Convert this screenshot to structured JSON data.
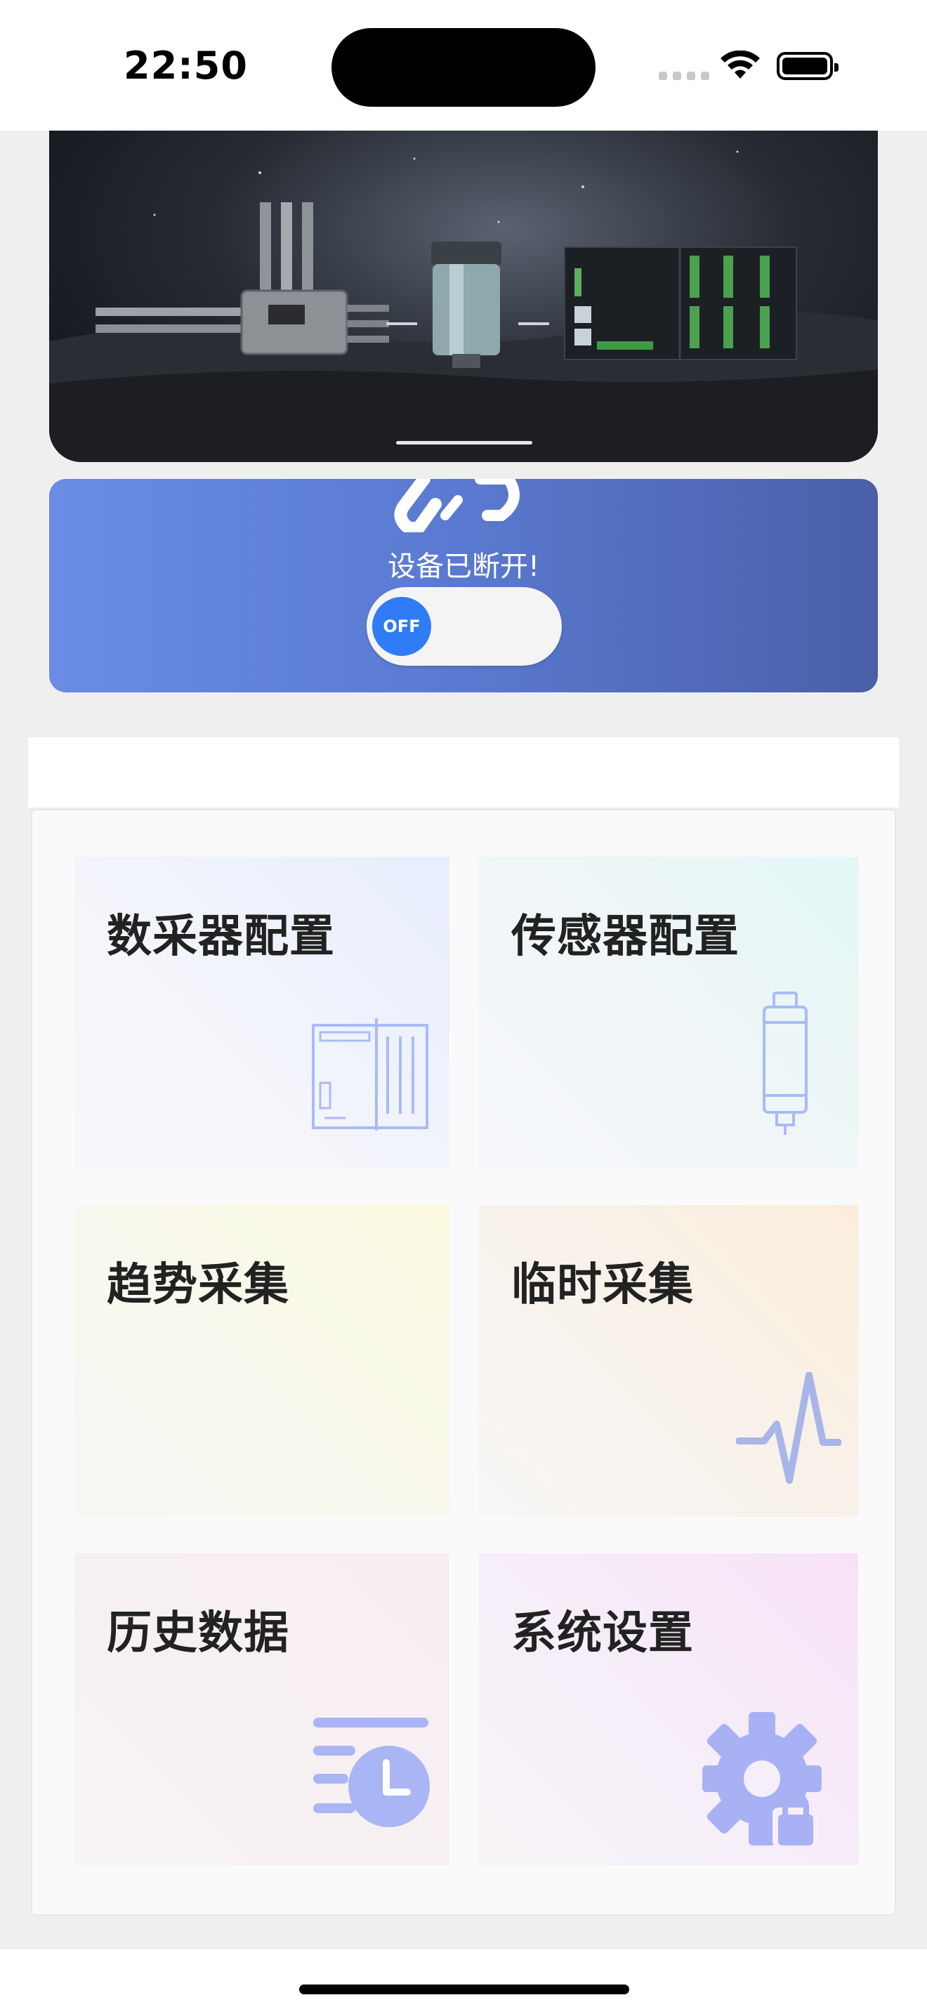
{
  "status_bar": {
    "time": "22:50"
  },
  "connection": {
    "status_text": "设备已断开!",
    "toggle_label": "OFF"
  },
  "menu": {
    "items": [
      {
        "label": "数采器配置",
        "icon": "data-logger-icon"
      },
      {
        "label": "传感器配置",
        "icon": "sensor-icon"
      },
      {
        "label": "趋势采集",
        "icon": "waveform-icon"
      },
      {
        "label": "临时采集",
        "icon": "pulse-icon"
      },
      {
        "label": "历史数据",
        "icon": "history-clock-icon"
      },
      {
        "label": "系统设置",
        "icon": "gear-lock-icon"
      }
    ]
  },
  "colors": {
    "accent": "#2f7cf6",
    "panel_start": "#6a8ce4",
    "panel_end": "#4a5fa8",
    "icon_blue": "#9fb2f5"
  }
}
